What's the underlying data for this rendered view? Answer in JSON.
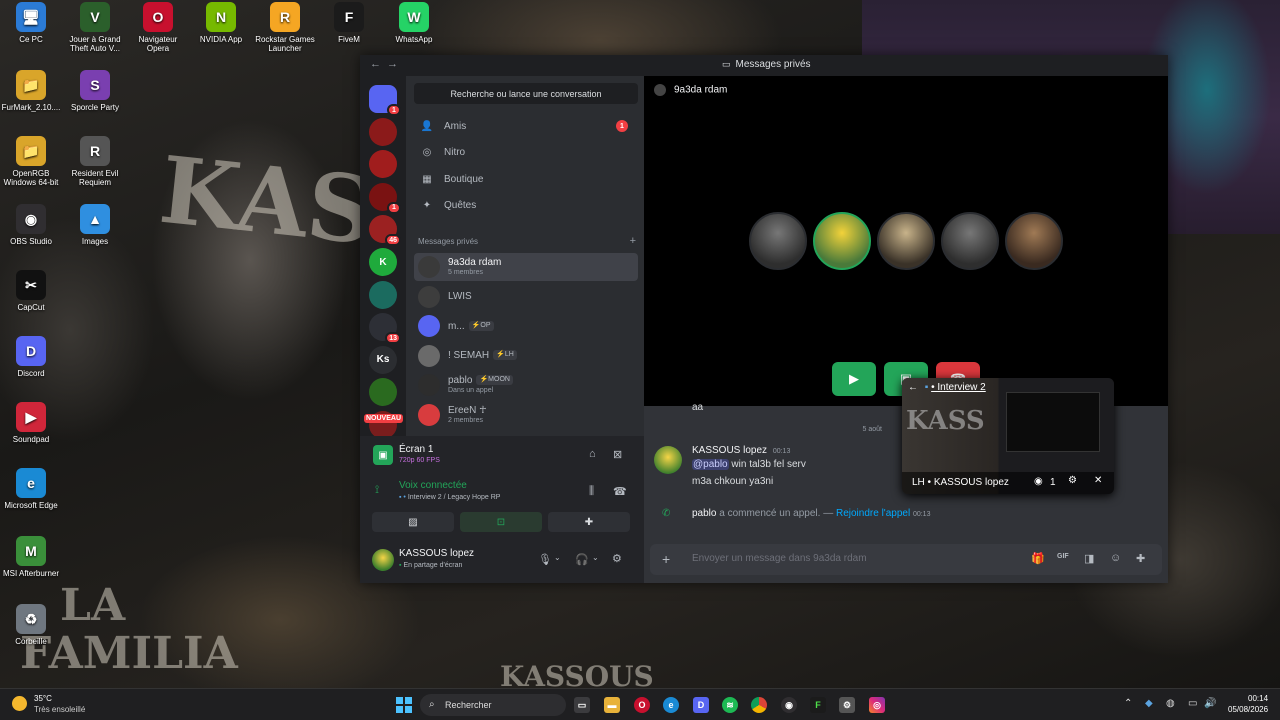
{
  "desktop": {
    "wallpaper_text": [
      "KASS",
      "LA",
      "FAMILIA",
      "KASSOUS"
    ],
    "icons": [
      {
        "label": "Ce PC",
        "color": "#2b7bd6",
        "glyph": "🖥"
      },
      {
        "label": "Jouer à Grand Theft Auto V...",
        "color": "#2b5f2b",
        "glyph": "V"
      },
      {
        "label": "Navigateur Opera",
        "color": "#c8102e",
        "glyph": "O"
      },
      {
        "label": "NVIDIA App",
        "color": "#76b900",
        "glyph": "N"
      },
      {
        "label": "Rockstar Games Launcher",
        "color": "#f5a623",
        "glyph": "R"
      },
      {
        "label": "FiveM",
        "color": "#1b1b1b",
        "glyph": "F"
      },
      {
        "label": "WhatsApp",
        "color": "#25d366",
        "glyph": "W"
      },
      {
        "label": "FurMark_2.10....",
        "color": "#d9a52a",
        "glyph": "📁"
      },
      {
        "label": "Sporcle Party",
        "color": "#7a3fb0",
        "glyph": "S"
      },
      {
        "label": "OpenRGB Windows 64-bit",
        "color": "#d9a52a",
        "glyph": "📁"
      },
      {
        "label": "Resident Evil Requiem",
        "color": "#555555",
        "glyph": "R"
      },
      {
        "label": "OBS Studio",
        "color": "#302e31",
        "glyph": "◉"
      },
      {
        "label": "Images",
        "color": "#2f8fe0",
        "glyph": "▲"
      },
      {
        "label": "CapCut",
        "color": "#111111",
        "glyph": "✂"
      },
      {
        "label": "Discord",
        "color": "#5865f2",
        "glyph": "D"
      },
      {
        "label": "Soundpad",
        "color": "#d0263a",
        "glyph": "▶"
      },
      {
        "label": "Microsoft Edge",
        "color": "#1a8ad4",
        "glyph": "e"
      },
      {
        "label": "MSI Afterburner",
        "color": "#3a8f3a",
        "glyph": "M"
      },
      {
        "label": "Corbeille",
        "color": "#6f7780",
        "glyph": "♻"
      }
    ]
  },
  "discord": {
    "titlebar": {
      "back": "←",
      "forward": "→",
      "title": "Messages privés"
    },
    "servers": [
      {
        "abbr": "",
        "color": "#5865f2",
        "badge": "1",
        "kind": "home"
      },
      {
        "abbr": "",
        "color": "#8b1a1a",
        "badge": ""
      },
      {
        "abbr": "",
        "color": "#a01d1d",
        "badge": ""
      },
      {
        "abbr": "",
        "color": "#7a1212",
        "badge": "1"
      },
      {
        "abbr": "",
        "color": "#9b2121",
        "badge": "46"
      },
      {
        "abbr": "K",
        "color": "#1faa3c",
        "badge": ""
      },
      {
        "abbr": "",
        "color": "#1b6b5f",
        "badge": ""
      },
      {
        "abbr": "",
        "color": "#2d2f36",
        "badge": "13"
      },
      {
        "abbr": "Ks",
        "color": "#2b2d31",
        "badge": ""
      },
      {
        "abbr": "",
        "color": "#2a6a1f",
        "badge": ""
      },
      {
        "abbr": "",
        "color": "#7a1d1d",
        "badge": ""
      }
    ],
    "new_label": "NOUVEAU",
    "search_placeholder": "Recherche ou lance une conversation",
    "nav": [
      {
        "label": "Amis",
        "icon": "friends-icon",
        "glyph": "👤",
        "badge": "1"
      },
      {
        "label": "Nitro",
        "icon": "nitro-icon",
        "glyph": "◎",
        "badge": ""
      },
      {
        "label": "Boutique",
        "icon": "shop-icon",
        "glyph": "▦",
        "badge": ""
      },
      {
        "label": "Quêtes",
        "icon": "quests-icon",
        "glyph": "✦",
        "badge": ""
      }
    ],
    "dm_header": "Messages privés",
    "dm_add": "+",
    "dms": [
      {
        "name": "9a3da rdam",
        "sub": "5 membres",
        "tag": "",
        "selected": true,
        "color": "#3a3a3a"
      },
      {
        "name": "LWIS",
        "sub": "",
        "tag": "",
        "selected": false,
        "color": "#3d3d3d"
      },
      {
        "name": "m...",
        "sub": "",
        "tag": "⚡OP",
        "selected": false,
        "color": "#5865f2"
      },
      {
        "name": "! SEMAH",
        "sub": "",
        "tag": "⚡LH",
        "selected": false,
        "color": "#6a6a6a"
      },
      {
        "name": "pablo",
        "sub": "Dans un appel",
        "tag": "⚡MOON",
        "selected": false,
        "color": "#2d2d2d"
      },
      {
        "name": "EreeN ☥",
        "sub": "2 membres",
        "tag": "",
        "selected": false,
        "color": "#d83c3e"
      }
    ],
    "screen": {
      "title": "Écran 1",
      "quality": "720p 60 FPS"
    },
    "voice": {
      "status": "Voix connectée",
      "channel": "Interview 2 / Legacy Hope RP"
    },
    "user": {
      "name": "KASSOUS lopez",
      "status": "En partage d'écran"
    },
    "chat": {
      "group_name": "9a3da rdam",
      "partial_message": "aa",
      "date_divider": "5 août",
      "messages": [
        {
          "author": "KASSOUS lopez",
          "time": "00:13",
          "mention": "@pablo",
          "line1": "win tal3b fel serv",
          "line2": "m3a chkoun ya3ni"
        }
      ],
      "system": {
        "author": "pablo",
        "text": "a commencé un appel. —",
        "link": "Rejoindre l'appel",
        "time": "00:13"
      },
      "composer_placeholder": "Envoyer un message dans 9a3da rdam"
    },
    "pip": {
      "title": "• Interview 2",
      "footer": "LH • KASSOUS lopez",
      "viewers": "1"
    }
  },
  "taskbar": {
    "weather_temp": "35°C",
    "weather_desc": "Très ensoleillé",
    "search_placeholder": "Rechercher",
    "time": "00:14",
    "date": "05/08/2026"
  }
}
